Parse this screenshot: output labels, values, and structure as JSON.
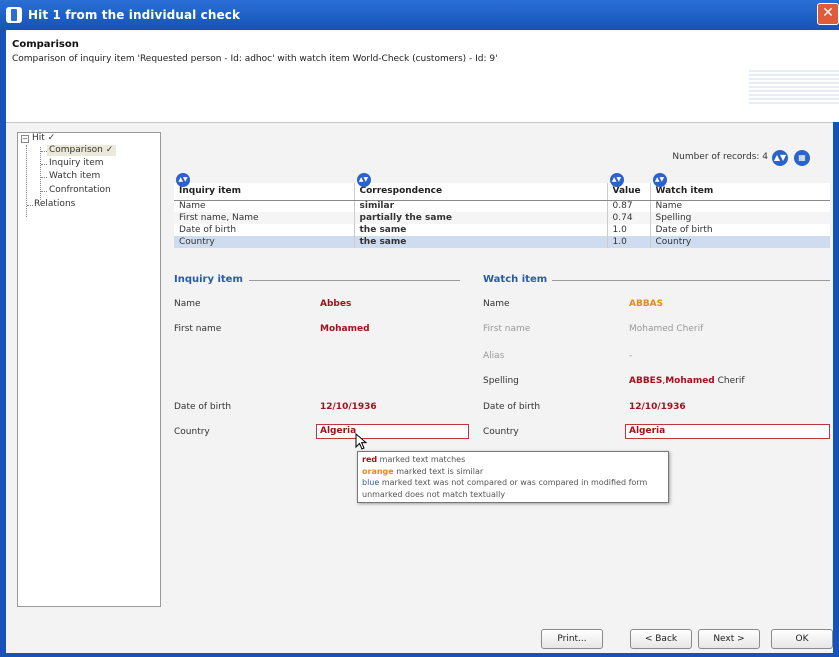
{
  "window": {
    "title": "Hit 1 from the individual check",
    "close_glyph": "✕"
  },
  "header": {
    "title": "Comparison",
    "subtitle": "Comparison of inquiry item 'Requested person - Id: adhoc' with watch item World-Check (customers) - Id: 9'"
  },
  "tree": {
    "root": "Hit ✓",
    "root_expander": "−",
    "items": [
      {
        "label": "Comparison ✓"
      },
      {
        "label": "Inquiry item"
      },
      {
        "label": "Watch item"
      },
      {
        "label": "Confrontation"
      }
    ],
    "relations": "Relations"
  },
  "records": {
    "label": "Number of records: 4"
  },
  "grid": {
    "headers": [
      "Inquiry item",
      "Correspondence",
      "Value",
      "Watch item"
    ],
    "rows": [
      {
        "inquiry": "Name",
        "correspondence": "similar",
        "value": "0.87",
        "watch": "Name"
      },
      {
        "inquiry": "First name, Name",
        "correspondence": "partially the same",
        "value": "0.74",
        "watch": "Spelling"
      },
      {
        "inquiry": "Date of birth",
        "correspondence": "the same",
        "value": "1.0",
        "watch": "Date of birth"
      },
      {
        "inquiry": "Country",
        "correspondence": "the same",
        "value": "1.0",
        "watch": "Country"
      }
    ]
  },
  "inquiry": {
    "section": "Inquiry item",
    "name_label": "Name",
    "name_value": "Abbes",
    "firstname_label": "First name",
    "firstname_value": "Mohamed",
    "dob_label": "Date of birth",
    "dob_value": "12/10/1936",
    "country_label": "Country",
    "country_value": "Algeria"
  },
  "watch": {
    "section": "Watch item",
    "name_label": "Name",
    "name_value": "ABBAS",
    "firstname_label": "First name",
    "firstname_value": "Mohamed Cherif",
    "alias_label": "Alias",
    "alias_value": "-",
    "spelling_label": "Spelling",
    "spelling_red": "ABBES",
    "spelling_comma": ",",
    "spelling_red2": "Mohamed",
    "spelling_plain": " Cherif",
    "dob_label": "Date of birth",
    "dob_value": "12/10/1936",
    "country_label": "Country",
    "country_value": "Algeria"
  },
  "legend": [
    {
      "key": "red",
      "text": " marked text matches",
      "color": "#a3111a"
    },
    {
      "key": "orange",
      "text": " marked text is similar",
      "color": "#e8891a"
    },
    {
      "key": "blue",
      "text": " marked text was not compared or was compared in modified form",
      "color": "#2a5aa8"
    },
    {
      "key": "unmarked",
      "text": " does not match textually",
      "color": "#555555"
    }
  ],
  "buttons": {
    "print": "Print...",
    "back": "< Back",
    "next": "Next >",
    "ok": "OK"
  }
}
